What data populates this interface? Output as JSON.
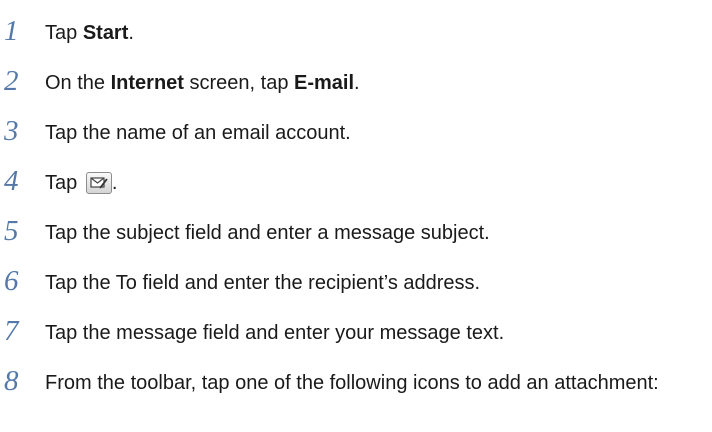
{
  "steps": [
    {
      "number": "1",
      "pre": "Tap ",
      "bold": "Start",
      "post": "."
    },
    {
      "number": "2",
      "t1": "On the ",
      "b1": "Internet",
      "t2": " screen, tap ",
      "b2": "E-mail",
      "t3": "."
    },
    {
      "number": "3",
      "text": "Tap the name of an email account."
    },
    {
      "number": "4",
      "pre": "Tap ",
      "icon": "compose-email-icon",
      "post": "."
    },
    {
      "number": "5",
      "text": "Tap the subject field and enter a message subject."
    },
    {
      "number": "6",
      "text": "Tap the To field and enter the recipient’s address."
    },
    {
      "number": "7",
      "text": "Tap the message field and enter your message text."
    },
    {
      "number": "8",
      "text": "From the toolbar, tap one of the following icons to add an attachment:"
    }
  ]
}
